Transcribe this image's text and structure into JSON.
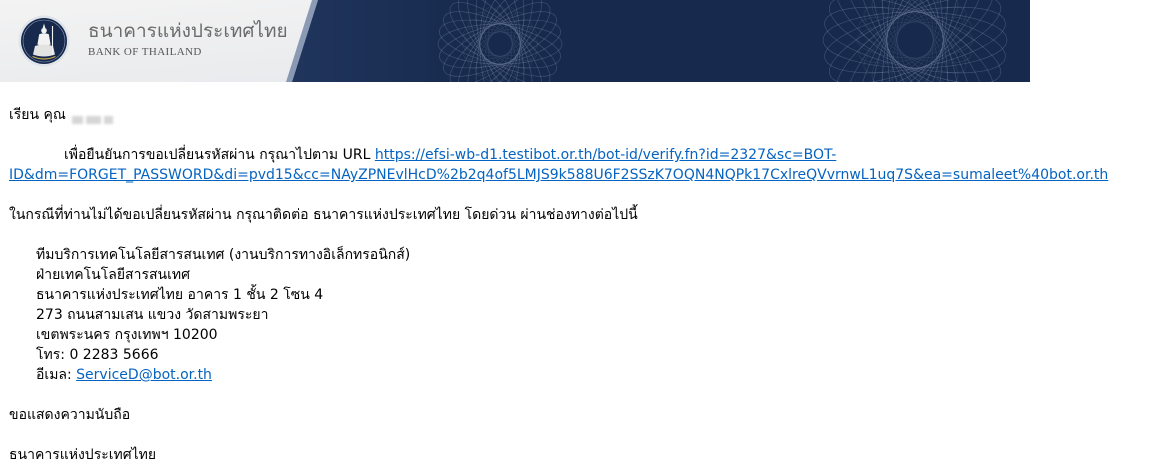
{
  "header": {
    "logo_thai": "ธนาคารแห่งประเทศไทย",
    "logo_english": "BANK OF THAILAND",
    "emblem_icon": "bank-of-thailand-emblem-icon"
  },
  "email": {
    "greeting": "เรียน คุณ",
    "verify_text": "เพื่อยืนยันการขอเปลี่ยนรหัสผ่าน กรุณาไปตาม URL",
    "verify_link_line1": "https://efsi-wb-d1.testibot.or.th/bot-id/verify.fn?id=2327&sc=BOT-",
    "verify_link_line2": "ID&dm=FORGET_PASSWORD&di=pvd15&cc=NAyZPNEvlHcD%2b2q4of5LMJS9k588U6F2SSzK7OQN4NQPk17CxlreQVvrnwL1uq7S&ea=sumaleet%40bot.or.th",
    "contact_intro": "ในกรณีที่ท่านไม่ได้ขอเปลี่ยนรหัสผ่าน กรุณาติดต่อ ธนาคารแห่งประเทศไทย โดยด่วน ผ่านช่องทางต่อไปนี้",
    "contact": {
      "team": "ทีมบริการเทคโนโลยีสารสนเทศ (งานบริการทางอิเล็กทรอนิกส์)",
      "department": "ฝ่ายเทคโนโลยีสารสนเทศ",
      "building": "ธนาคารแห่งประเทศไทย อาคาร 1 ชั้น 2 โซน 4",
      "street": "273 ถนนสามเสน แขวง วัดสามพระยา",
      "district": "เขตพระนคร กรุงเทพฯ 10200",
      "phone_label": "โทร:",
      "phone": "0 2283 5666",
      "email_label": "อีเมล:",
      "email": "ServiceD@bot.or.th"
    },
    "closing": "ขอแสดงความนับถือ",
    "signature": "ธนาคารแห่งประเทศไทย"
  },
  "colors": {
    "header_navy": "#172a4d",
    "header_navy_light": "#20355d",
    "header_light": "#f3f3f3",
    "logo_text": "#6b6b6b",
    "link": "#0563c1",
    "text": "#000000"
  }
}
